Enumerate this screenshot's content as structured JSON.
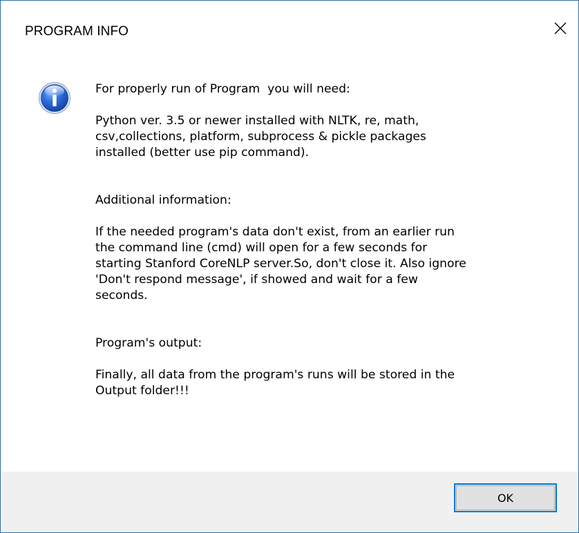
{
  "dialog": {
    "title": "PROGRAM INFO",
    "icon": "information-icon",
    "message": "For properly run of Program  you will need:\n\nPython ver. 3.5 or newer installed with NLTK, re, math,\ncsv,collections, platform, subprocess & pickle packages\ninstalled (better use pip command).\n\n\nAdditional information:\n\nIf the needed program's data don't exist, from an earlier run\nthe command line (cmd) will open for a few seconds for\nstarting Stanford CoreNLP server.So, don't close it. Also ignore\n'Don't respond message', if showed and wait for a few\nseconds.\n\n\nProgram's output:\n\nFinally, all data from the program's runs will be stored in the\nOutput folder!!!",
    "ok_label": "OK",
    "close_icon": "close-icon"
  },
  "colors": {
    "window_border": "#2b6ea8",
    "footer_bg": "#f0f0f0",
    "button_focus_border": "#0078d7",
    "button_bg": "#e1e1e1"
  }
}
